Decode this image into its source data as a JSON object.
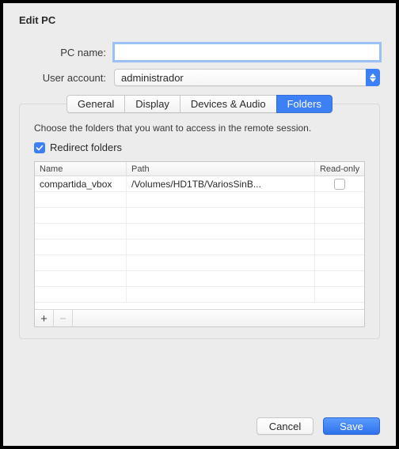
{
  "header": {
    "title": "Edit PC"
  },
  "form": {
    "pc_name": {
      "label": "PC name:",
      "value": ""
    },
    "user_account": {
      "label": "User account:",
      "selected": "administrador"
    }
  },
  "tabs": {
    "items": [
      {
        "label": "General"
      },
      {
        "label": "Display"
      },
      {
        "label": "Devices & Audio"
      },
      {
        "label": "Folders"
      }
    ],
    "active_index": 3
  },
  "folders_panel": {
    "instruction": "Choose the folders that you want to access in the remote session.",
    "redirect_checkbox": {
      "label": "Redirect folders",
      "checked": true
    },
    "columns": {
      "name": "Name",
      "path": "Path",
      "readonly": "Read-only"
    },
    "rows": [
      {
        "name": "compartida_vbox",
        "path": "/Volumes/HD1TB/VariosSinB...",
        "readonly": false
      }
    ],
    "footer": {
      "add": "+",
      "remove": "−"
    }
  },
  "buttons": {
    "cancel": "Cancel",
    "save": "Save"
  }
}
